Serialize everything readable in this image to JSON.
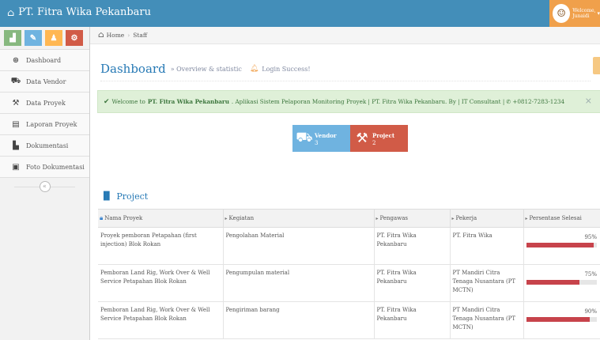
{
  "app": {
    "title": "PT. Fitra Wika Pekanbaru"
  },
  "user": {
    "greeting": "Welcome,",
    "name": "Junaidi"
  },
  "sidebar": {
    "shortcuts": [
      {
        "icon": "signal-icon",
        "glyph": "▟",
        "color": "#87b87f"
      },
      {
        "icon": "pencil-icon",
        "glyph": "✎",
        "color": "#6fb3e0"
      },
      {
        "icon": "users-icon",
        "glyph": "♟",
        "color": "#ffb752"
      },
      {
        "icon": "cogs-icon",
        "glyph": "⚙",
        "color": "#d15b47"
      }
    ],
    "items": [
      {
        "label": "Dashboard",
        "icon": "dashboard-icon",
        "glyph": "⊛"
      },
      {
        "label": "Data Vendor",
        "icon": "truck-icon",
        "glyph": "⛟"
      },
      {
        "label": "Data Proyek",
        "icon": "hammer-icon",
        "glyph": "⚒"
      },
      {
        "label": "Laporan Proyek",
        "icon": "book-icon",
        "glyph": "▤"
      },
      {
        "label": "Dokumentasi",
        "icon": "file-icon",
        "glyph": "▙"
      },
      {
        "label": "Foto Dokumentasi",
        "icon": "picture-icon",
        "glyph": "▣"
      }
    ]
  },
  "breadcrumb": {
    "home": "Home",
    "current": "Staff"
  },
  "header": {
    "title": "Dashboard",
    "subtitle": "Overview & statistic",
    "notice": "Login Success!"
  },
  "alert": {
    "prefix": "Welcome to",
    "company": "PT. Fitra Wika Pekanbaru",
    "text": ". Aplikasi Sistem Pelaporan Monitoring Proyek | PT. Fitra Wika Pekanbaru. By | IT Consultant |",
    "phone": "+0812-7283-1234"
  },
  "stats": {
    "vendor": {
      "label": "Vendor",
      "value": "3"
    },
    "project": {
      "label": "Project",
      "value": "2"
    }
  },
  "project_section": {
    "title": "Project",
    "columns": [
      "Nama Proyek",
      "Kegiatan",
      "Pengawas",
      "Pekerja",
      "Persentase Selesai"
    ],
    "rows": [
      {
        "nama": "Proyek pemboran Petapahan (first injection) Blok Rokan",
        "kegiatan": "Pengolahan Material",
        "pengawas": "PT. Fitra Wika Pekanbaru",
        "pekerja": "PT. Fitra Wika",
        "persen": "95%",
        "progress": 0.95
      },
      {
        "nama": "Pemboran Land Rig, Work Over & Well Service Petapahan Blok Rokan",
        "kegiatan": "Pengumpulan material",
        "pengawas": "PT. Fitra Wika Pekanbaru",
        "pekerja": "PT Mandiri Citra Tenaga Nusantara (PT MCTN)",
        "persen": "75%",
        "progress": 0.75
      },
      {
        "nama": "Pemboran Land Rig, Work Over & Well Service Petapahan Blok Rokan",
        "kegiatan": "Pengiriman barang",
        "pengawas": "PT. Fitra Wika Pekanbaru",
        "pekerja": "PT Mandiri Citra Tenaga Nusantara (PT MCTN)",
        "persen": "90%",
        "progress": 0.9
      }
    ]
  }
}
